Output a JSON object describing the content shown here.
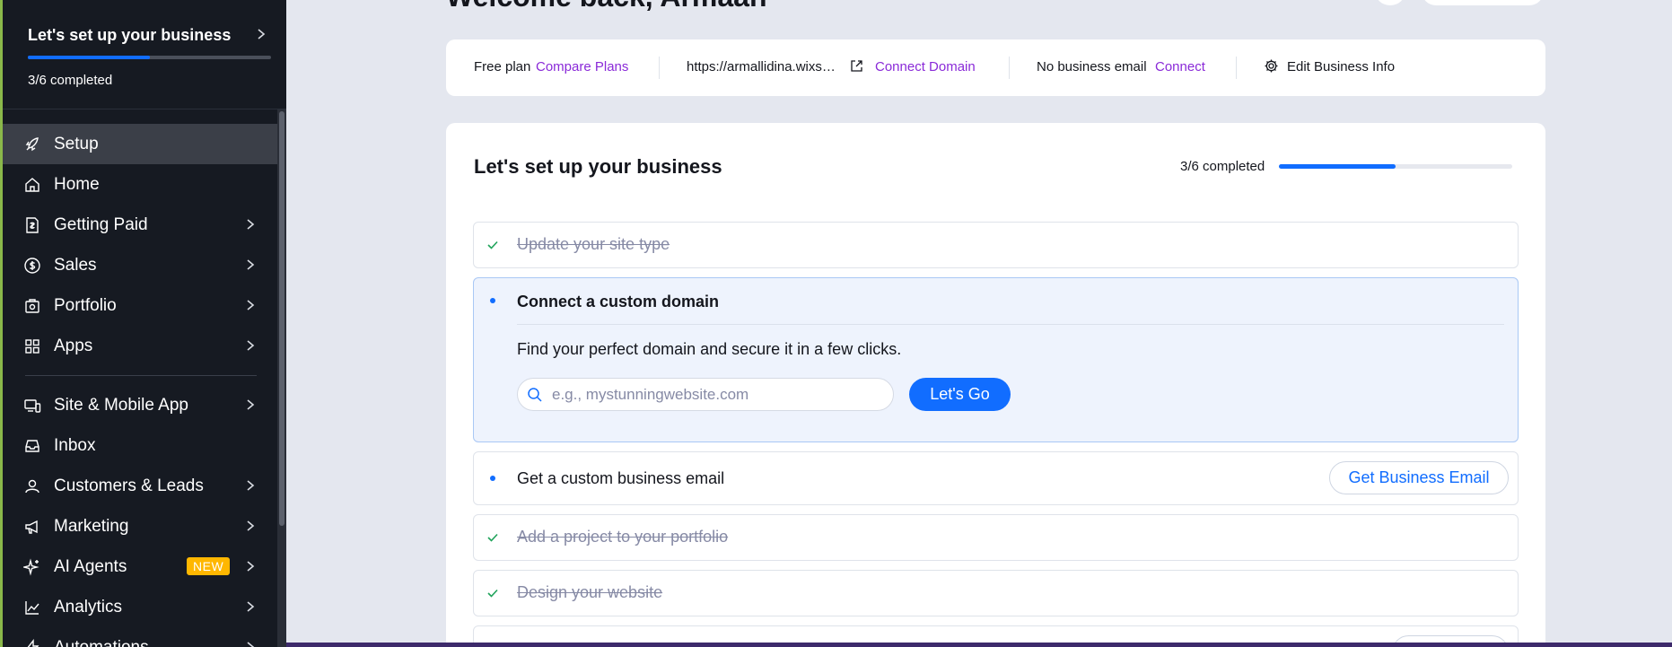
{
  "sidebar": {
    "setup_card": {
      "title": "Let's set up your business",
      "status": "3/6 completed",
      "progress": 0.5
    },
    "items": [
      {
        "label": "Setup",
        "icon": "rocket-icon",
        "has_chevron": false,
        "active": true
      },
      {
        "label": "Home",
        "icon": "home-icon",
        "has_chevron": false
      },
      {
        "label": "Getting Paid",
        "icon": "invoice-icon",
        "has_chevron": true
      },
      {
        "label": "Sales",
        "icon": "dollar-icon",
        "has_chevron": true
      },
      {
        "label": "Portfolio",
        "icon": "portfolio-icon",
        "has_chevron": true
      },
      {
        "label": "Apps",
        "icon": "apps-icon",
        "has_chevron": true
      },
      {
        "label": "Site & Mobile App",
        "icon": "devices-icon",
        "has_chevron": true
      },
      {
        "label": "Inbox",
        "icon": "inbox-icon",
        "has_chevron": false
      },
      {
        "label": "Customers & Leads",
        "icon": "customers-icon",
        "has_chevron": true
      },
      {
        "label": "Marketing",
        "icon": "megaphone-icon",
        "has_chevron": true
      },
      {
        "label": "AI Agents",
        "icon": "sparkle-icon",
        "has_chevron": true,
        "badge": "NEW"
      },
      {
        "label": "Analytics",
        "icon": "analytics-icon",
        "has_chevron": true
      },
      {
        "label": "Automations",
        "icon": "bolt-icon",
        "has_chevron": true
      }
    ]
  },
  "header": {
    "welcome": "Welcome back, Armaan"
  },
  "info_bar": {
    "plan_text": "Free plan",
    "compare_plans": "Compare Plans",
    "site_url": "https://armallidina.wixs…",
    "connect_domain": "Connect Domain",
    "email_text": "No business email",
    "email_connect": "Connect",
    "edit_info": "Edit Business Info"
  },
  "setup": {
    "title": "Let's set up your business",
    "status": "3/6 completed",
    "progress": 0.5,
    "steps": [
      {
        "label": "Update your site type",
        "done": true
      },
      {
        "label": "Connect a custom domain",
        "done": false,
        "expanded": true,
        "description": "Find your perfect domain and secure it in a few clicks.",
        "input_placeholder": "e.g., mystunningwebsite.com",
        "button": "Let's Go"
      },
      {
        "label": "Get a custom business email",
        "done": false,
        "button": "Get Business Email"
      },
      {
        "label": "Add a project to your portfolio",
        "done": true
      },
      {
        "label": "Design your website",
        "done": true
      }
    ]
  },
  "colors": {
    "accent_blue": "#116dff",
    "link_purple": "#8a2ad8",
    "sidebar_bg": "#161a22",
    "check_green": "#1fa35a",
    "badge_yellow": "#ffb700"
  }
}
